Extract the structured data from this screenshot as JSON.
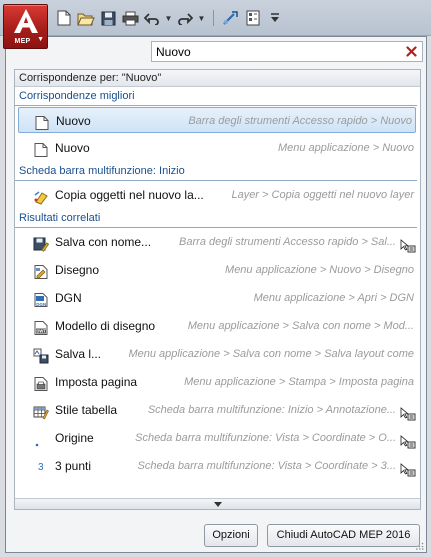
{
  "app_button": {
    "label": "MEP",
    "icon": "autocad-a-logo-icon",
    "color": "#b5201d"
  },
  "quick_access_toolbar": {
    "items": [
      {
        "name": "new-file-icon"
      },
      {
        "name": "open-folder-icon"
      },
      {
        "name": "save-icon"
      },
      {
        "name": "print-icon"
      },
      {
        "name": "undo-icon"
      },
      {
        "name": "redo-icon"
      },
      {
        "name": "workspace-switch-icon"
      },
      {
        "name": "properties-icon"
      },
      {
        "name": "customize-dropdown-icon"
      }
    ]
  },
  "search": {
    "value": "Nuovo",
    "clear_icon": "clear-x-icon"
  },
  "results": {
    "header": "Corrispondenze per: \"Nuovo\"",
    "sections": {
      "best": "Corrispondenze migliori",
      "ribbon": "Scheda barra multifunzione: Inizio",
      "related": "Risultati correlati"
    },
    "best_items": [
      {
        "label": "Nuovo",
        "path": "Barra degli strumenti Accesso rapido > Nuovo",
        "icon": "new-document-icon",
        "selected": true
      },
      {
        "label": "Nuovo",
        "path": "Menu applicazione > Nuovo",
        "icon": "new-document-icon"
      }
    ],
    "ribbon_items": [
      {
        "label": "Copia oggetti nel nuovo la...",
        "path": "Layer > Copia oggetti nel nuovo layer",
        "icon": "copy-to-layer-icon"
      }
    ],
    "related_items": [
      {
        "label": "Salva con nome...",
        "path": "Barra degli strumenti Accesso rapido > Sal...",
        "icon": "save-as-icon",
        "extra_icon": "cursor-select-icon"
      },
      {
        "label": "Disegno",
        "path": "Menu applicazione > Nuovo > Disegno",
        "icon": "drawing-icon"
      },
      {
        "label": "DGN",
        "path": "Menu applicazione > Apri > DGN",
        "icon": "dgn-file-icon"
      },
      {
        "label": "Modello di disegno",
        "path": "Menu applicazione > Salva con nome > Mod...",
        "icon": "dwt-template-icon"
      },
      {
        "label": "Salva l...",
        "path": "Menu applicazione > Salva con nome > Salva layout come",
        "icon": "save-layout-icon"
      },
      {
        "label": "Imposta pagina",
        "path": "Menu applicazione > Stampa > Imposta pagina",
        "icon": "page-setup-icon"
      },
      {
        "label": "Stile tabella",
        "path": "Scheda barra multifunzione: Inizio > Annotazione...",
        "icon": "table-style-icon",
        "extra_icon": "cursor-select-icon"
      },
      {
        "label": "Origine",
        "path": "Scheda barra multifunzione: Vista > Coordinate > O...",
        "icon": "ucs-origin-icon",
        "extra_icon": "cursor-select-icon"
      },
      {
        "label": "3 punti",
        "path": "Scheda barra multifunzione: Vista > Coordinate > 3...",
        "icon": "ucs-3-points-icon",
        "extra_icon": "cursor-select-icon"
      }
    ]
  },
  "footer": {
    "options_label": "Opzioni",
    "exit_label": "Chiudi AutoCAD MEP 2016"
  }
}
